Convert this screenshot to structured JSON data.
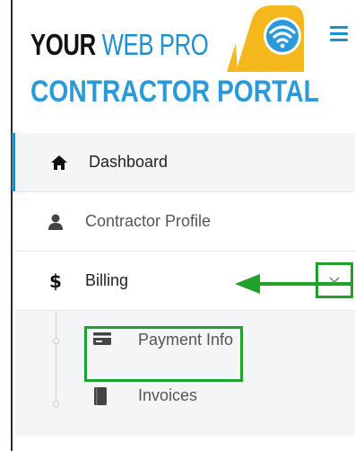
{
  "logo": {
    "line1_your": "YOUR",
    "line1_webpro": "WEB PRO",
    "line2": "CONTRACTOR PORTAL",
    "icon": "wifi-tape-measure-icon"
  },
  "header": {
    "menu_toggle_icon": "hamburger-icon"
  },
  "menu": {
    "items": [
      {
        "label": "Dashboard",
        "icon": "home-icon",
        "active": true
      },
      {
        "label": "Contractor Profile",
        "icon": "user-icon"
      },
      {
        "label": "Billing",
        "icon": "dollar-icon",
        "expanded": true,
        "toggle_icon": "chevron-down-icon"
      }
    ],
    "billing_subitems": [
      {
        "label": "Payment Info",
        "icon": "credit-card-icon"
      },
      {
        "label": "Invoices",
        "icon": "book-icon",
        "highlighted": true
      }
    ]
  },
  "annotations": {
    "highlight_color": "#1fa12a",
    "arrow_icon": "arrow-left-icon"
  },
  "colors": {
    "brand_blue": "#1e8fd0",
    "tape_yellow": "#f5b81c",
    "active_bg": "#f4f5f6"
  }
}
